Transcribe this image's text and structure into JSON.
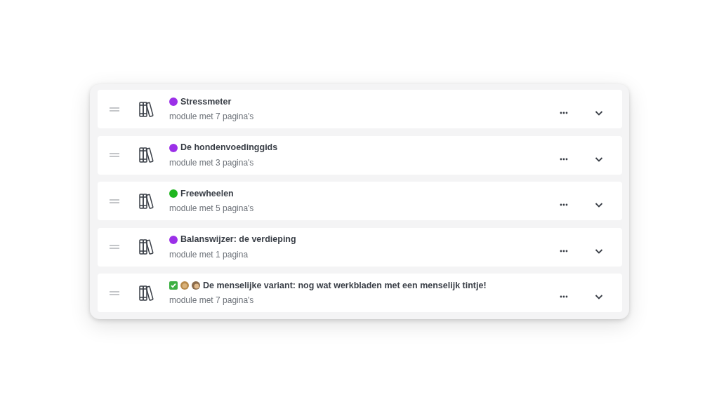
{
  "modules": [
    {
      "title": "Stressmeter",
      "subtitle": "module met 7 pagina's",
      "marker": {
        "kind": "dot",
        "color": "#9b30e8"
      }
    },
    {
      "title": "De hondenvoedinggids",
      "subtitle": "module met 3 pagina's",
      "marker": {
        "kind": "dot",
        "color": "#9b30e8"
      }
    },
    {
      "title": "Freewheelen",
      "subtitle": "module met 5 pagina's",
      "marker": {
        "kind": "dot",
        "color": "#1fb61f"
      }
    },
    {
      "title": "Balanswijzer: de verdieping",
      "subtitle": "module met 1 pagina",
      "marker": {
        "kind": "dot",
        "color": "#9b30e8"
      }
    },
    {
      "title": "De menselijke variant: nog wat werkbladen met een menselijk tintje!",
      "subtitle": "module met 7 pagina's",
      "marker": {
        "kind": "emojis"
      }
    }
  ]
}
